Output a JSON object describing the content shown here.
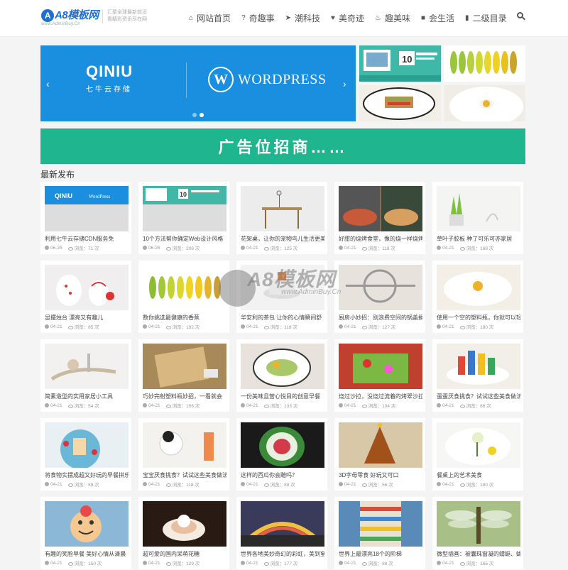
{
  "header": {
    "logo_text": "A8模板网",
    "logo_badge": "A",
    "logo_sub": "www.AdminBuy.Cn",
    "slogan_line1": "汇聚全球最新前沿",
    "slogan_line2": "看精彩资讯尽在网",
    "nav": [
      {
        "label": "网站首页",
        "icon": "home-icon",
        "glyph": "⌂"
      },
      {
        "label": "奇趣事",
        "icon": "question-icon",
        "glyph": "?"
      },
      {
        "label": "潮科技",
        "icon": "paper-plane-icon",
        "glyph": "➤"
      },
      {
        "label": "美奇迹",
        "icon": "heart-icon",
        "glyph": "♥"
      },
      {
        "label": "趣美味",
        "icon": "food-icon",
        "glyph": "♨"
      },
      {
        "label": "会生活",
        "icon": "tag-icon",
        "glyph": "■"
      },
      {
        "label": "二级目录",
        "icon": "book-icon",
        "glyph": "▮"
      }
    ]
  },
  "slider": {
    "qiniu_logo": "QINIU",
    "qiniu_sub": "七牛云存储",
    "wp_mark": "W",
    "wp_text": "WORDPRESS",
    "arrow_left": "‹",
    "arrow_right": "›",
    "slides": 2,
    "active": 1
  },
  "ad": {
    "text": "广告位招商……"
  },
  "section_title": "最新发布",
  "posts": [
    {
      "title": "利用七牛云存储CDN服务免",
      "date": "06-26",
      "views": "浏览：71 次",
      "thumb": "qiniu"
    },
    {
      "title": "10个方法帮你确定Web设计风格",
      "date": "06-26",
      "views": "浏览：208 次",
      "thumb": "web"
    },
    {
      "title": "花架桌，让你的宠物鸟儿生活更美",
      "date": "04-21",
      "views": "浏览：125 次",
      "thumb": "table"
    },
    {
      "title": "好甜的烧烤食堂，像的烧一样烧烤",
      "date": "04-21",
      "views": "浏览：118 次",
      "thumb": "bbq"
    },
    {
      "title": "草叶子胶板 种了可乐可亦家居",
      "date": "04-21",
      "views": "浏览：168 次",
      "thumb": "grass"
    },
    {
      "title": "显擺烛台 漂亮又有趣儿",
      "date": "04-21",
      "views": "浏览：85 次",
      "thumb": "lamp"
    },
    {
      "title": "数你挑选最健康的香蕉",
      "date": "04-21",
      "views": "浏览：192 次",
      "thumb": "banana"
    },
    {
      "title": "华安利的茶包 让你的心情瞬间舒",
      "date": "04-21",
      "views": "浏览：118 次",
      "thumb": "tea"
    },
    {
      "title": "厨房小妙招：别浪费空间的锅盖搁",
      "date": "04-21",
      "views": "浏览：127 次",
      "thumb": "lid"
    },
    {
      "title": "使用一个空的塑料瓶，你就可以轻",
      "date": "04-21",
      "views": "浏览：180 次",
      "thumb": "egg"
    },
    {
      "title": "简素造型的实用家居小工具",
      "date": "04-21",
      "views": "浏览：54 次",
      "thumb": "tools"
    },
    {
      "title": "巧妙完射塑料瓶妙招，一看就会",
      "date": "04-21",
      "views": "浏览：156 次",
      "thumb": "bottle"
    },
    {
      "title": "一份美味且营心悦目的创意早餐",
      "date": "04-21",
      "views": "浏览：133 次",
      "thumb": "breakfast"
    },
    {
      "title": "烧过沙拉，没烧过流着的烤翠沙拉",
      "date": "04-21",
      "views": "浏览：104 次",
      "thumb": "salad"
    },
    {
      "title": "蛋蛋厌食挑食？试试这些美食做法",
      "date": "04-21",
      "views": "浏览：88 次",
      "thumb": "castle"
    },
    {
      "title": "将食物实摆成超又好玩的早餐拼乐",
      "date": "04-21",
      "views": "浏览：88 次",
      "thumb": "plate"
    },
    {
      "title": "宝宝厌食挑食？试试这些美食做法",
      "date": "04-21",
      "views": "浏览：118 次",
      "thumb": "pencil"
    },
    {
      "title": "这样的西瓜你会雕吗？",
      "date": "04-21",
      "views": "浏览：88 次",
      "thumb": "melon"
    },
    {
      "title": "3D字母零食 好玩又可口",
      "date": "04-21",
      "views": "浏览：56 次",
      "thumb": "tree"
    },
    {
      "title": "餐桌上的艺术美食",
      "date": "04-21",
      "views": "浏览：180 次",
      "thumb": "art"
    },
    {
      "title": "有趣的笑脸早餐 美好心情从清晨",
      "date": "04-21",
      "views": "浏览：150 次",
      "thumb": "smile"
    },
    {
      "title": "超可爱的国内呆萌花糖",
      "date": "04-21",
      "views": "浏览：129 次",
      "thumb": "cup"
    },
    {
      "title": "世界各地美妙奇幻的彩虹，美到窒",
      "date": "04-21",
      "views": "浏览：177 次",
      "thumb": "rainbow"
    },
    {
      "title": "世界上最漂亮18个的阶梯",
      "date": "04-21",
      "views": "浏览：88 次",
      "thumb": "stairs"
    },
    {
      "title": "微型插画：被囊珠窗凝的蜻蜓、蝴",
      "date": "04-21",
      "views": "浏览：165 次",
      "thumb": "dragonfly"
    }
  ],
  "watermark": {
    "text": "A8模板网",
    "sub": "www.AdminBuy.Cn"
  }
}
